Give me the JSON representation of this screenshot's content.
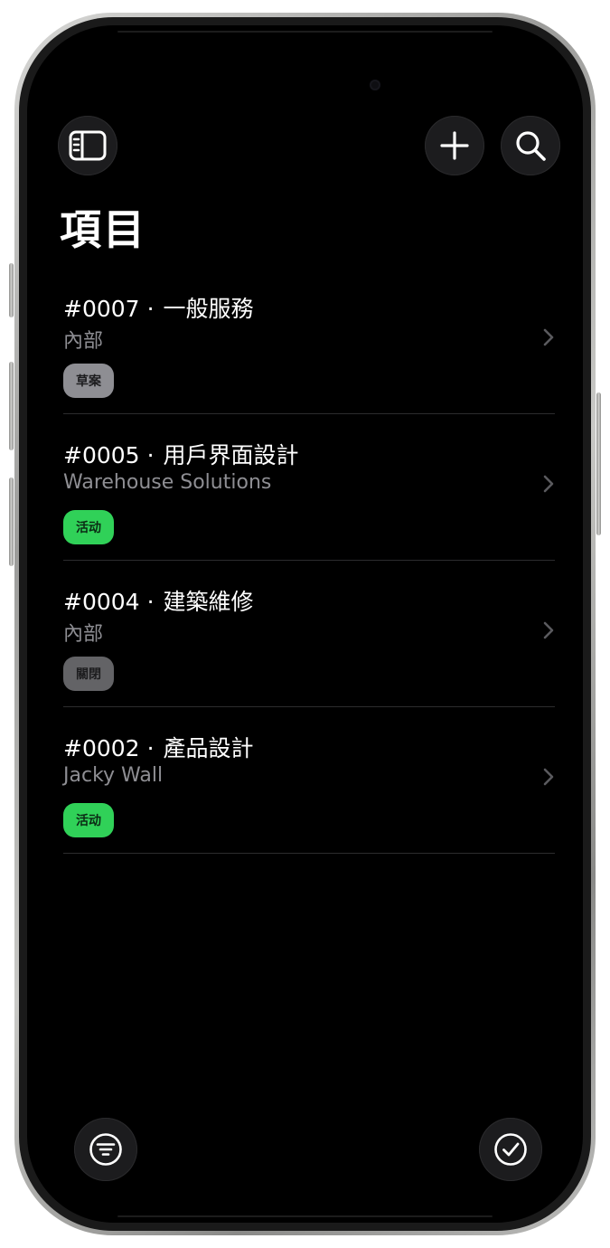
{
  "header": {
    "title": "項目"
  },
  "projects": [
    {
      "number": "#0007",
      "name": "一般服務",
      "client": "內部",
      "status": "草案",
      "status_kind": "draft"
    },
    {
      "number": "#0005",
      "name": "用戶界面設計",
      "client": "Warehouse Solutions",
      "status": "活动",
      "status_kind": "active"
    },
    {
      "number": "#0004",
      "name": "建築維修",
      "client": "內部",
      "status": "關閉",
      "status_kind": "closed"
    },
    {
      "number": "#0002",
      "name": "產品設計",
      "client": "Jacky Wall",
      "status": "活动",
      "status_kind": "active"
    }
  ],
  "separator": "·",
  "colors": {
    "background": "#000000",
    "button_bg": "#1c1c1e",
    "status_draft": "#8e8e93",
    "status_active": "#30d158",
    "status_closed": "#636366",
    "secondary_text": "#8e8e93"
  },
  "icons": {
    "sidebar": "sidebar-icon",
    "add": "plus-icon",
    "search": "search-icon",
    "filter": "filter-icon",
    "select": "checkmark-circle-icon",
    "row": "chevron-right-icon"
  }
}
